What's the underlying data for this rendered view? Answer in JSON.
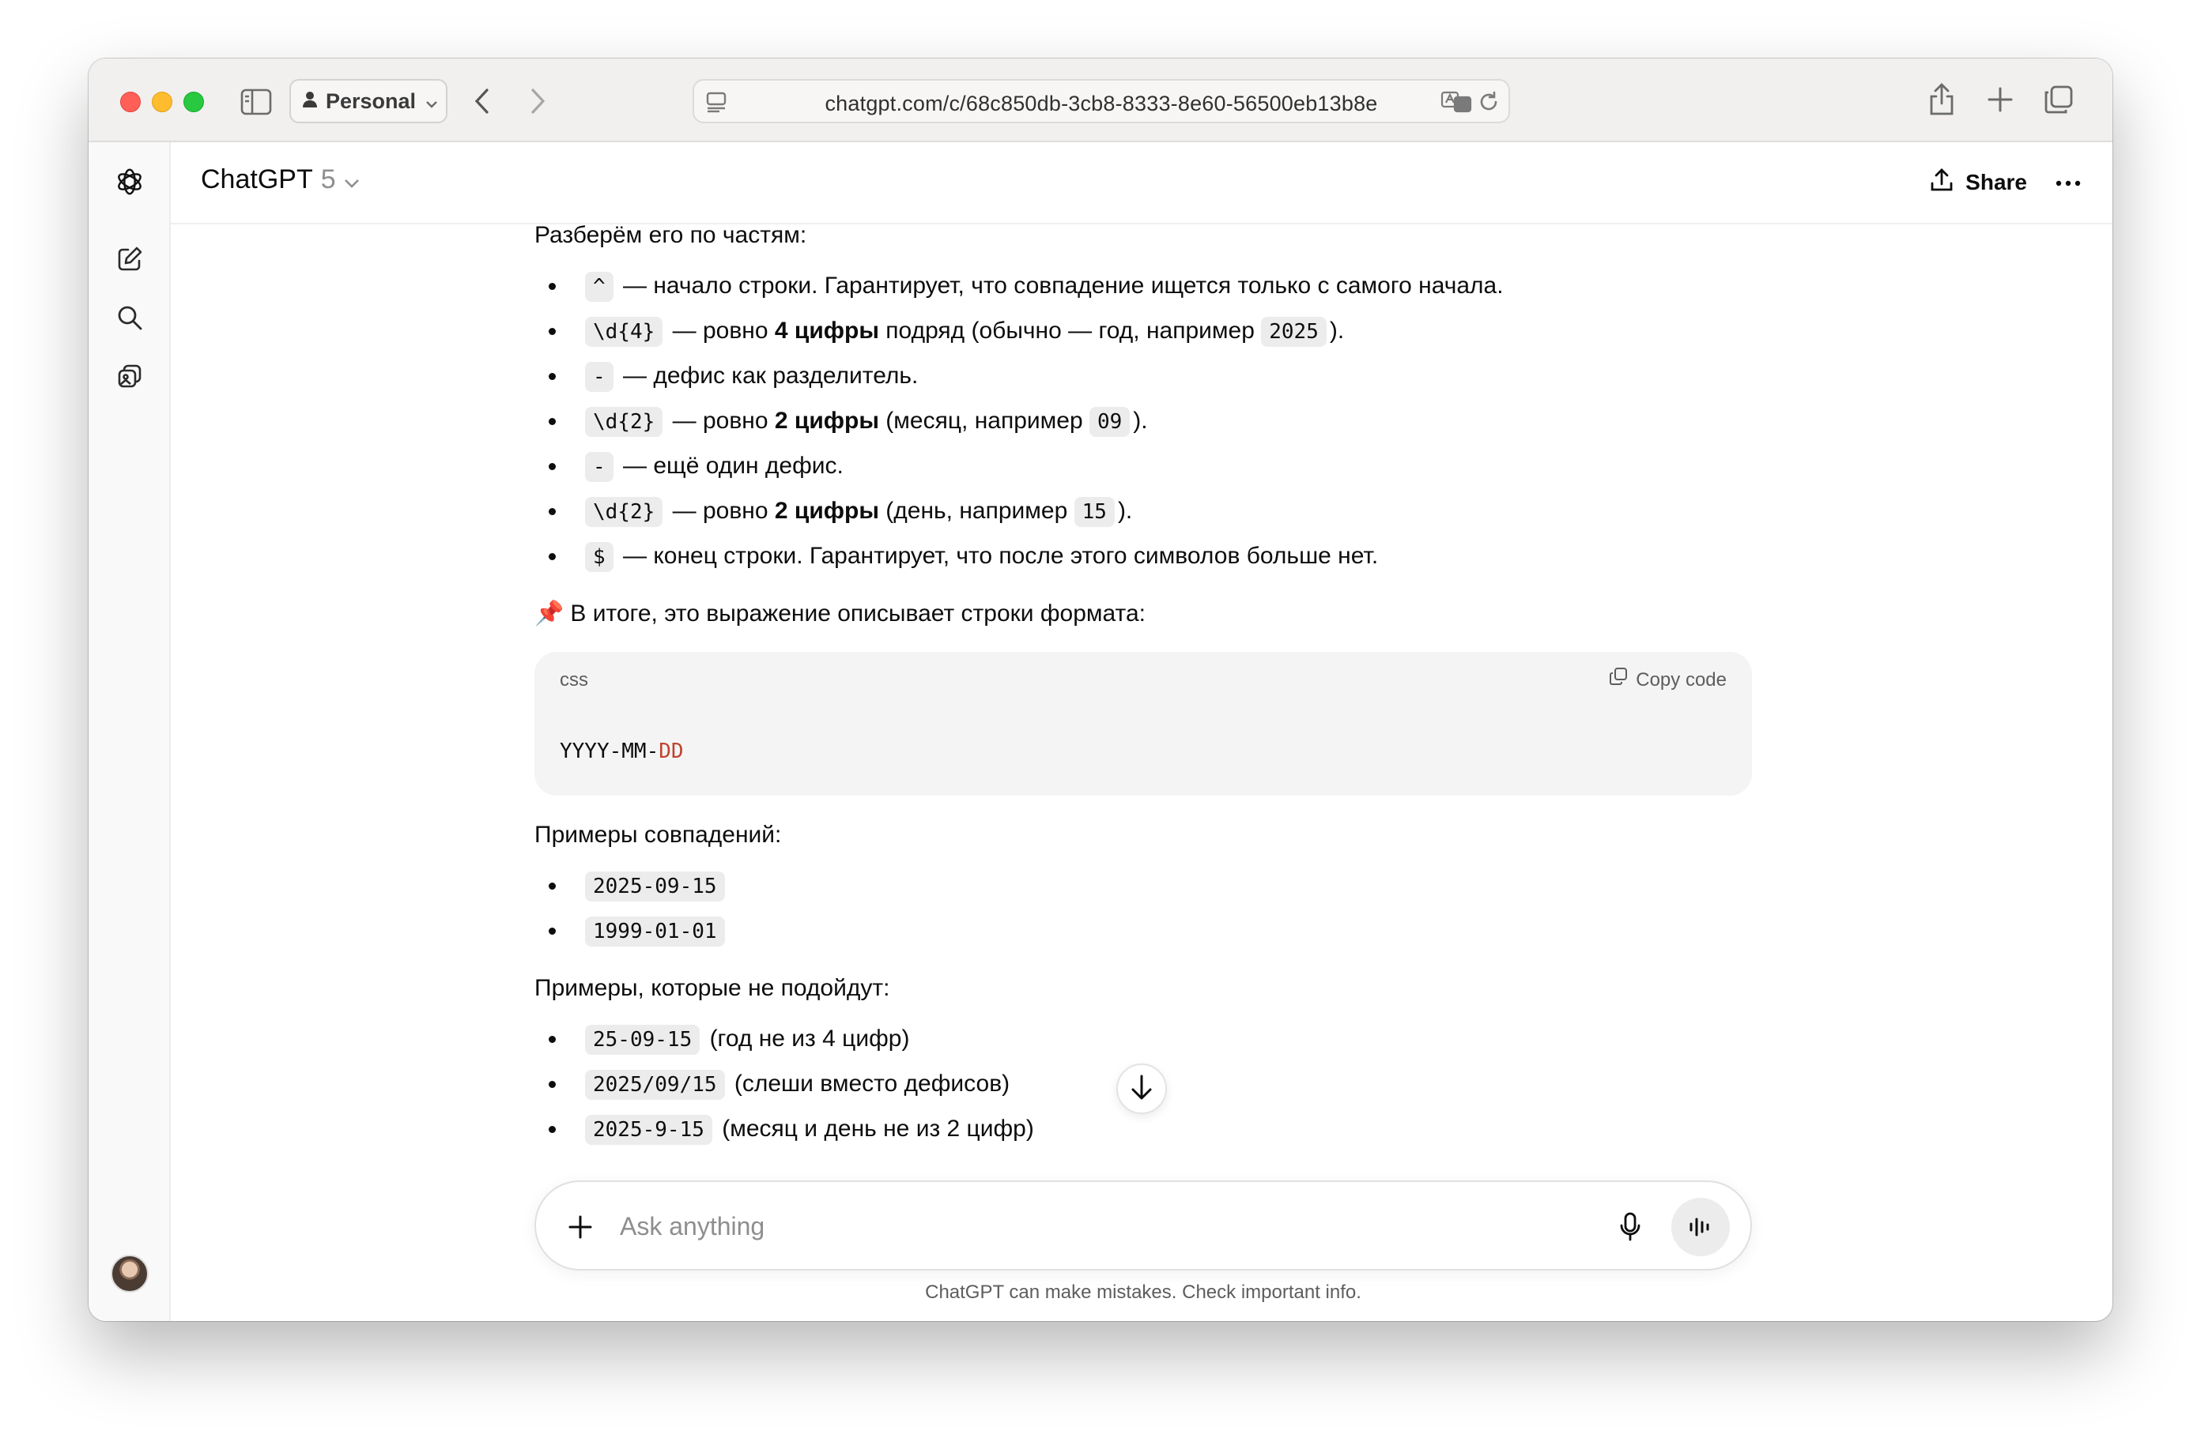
{
  "browser": {
    "profile_label": "Personal",
    "url": "chatgpt.com/c/68c850db-3cb8-8333-8e60-56500eb13b8e"
  },
  "header": {
    "app_name": "ChatGPT",
    "model_version": "5",
    "share_label": "Share"
  },
  "message": {
    "intro": "Разберём его по частям:",
    "parts": [
      {
        "code": "^",
        "segments": [
          {
            "t": " — начало строки. Гарантирует, что совпадение ищется только с самого начала.",
            "bold": false
          }
        ]
      },
      {
        "code": "\\d{4}",
        "segments": [
          {
            "t": " — ровно ",
            "bold": false
          },
          {
            "t": "4 цифры",
            "bold": true
          },
          {
            "t": " подряд (обычно — год, например ",
            "bold": false
          },
          {
            "code": "2025"
          },
          {
            "t": ").",
            "bold": false
          }
        ]
      },
      {
        "code": "-",
        "segments": [
          {
            "t": " — дефис как разделитель.",
            "bold": false
          }
        ]
      },
      {
        "code": "\\d{2}",
        "segments": [
          {
            "t": " — ровно ",
            "bold": false
          },
          {
            "t": "2 цифры",
            "bold": true
          },
          {
            "t": " (месяц, например ",
            "bold": false
          },
          {
            "code": "09"
          },
          {
            "t": ").",
            "bold": false
          }
        ]
      },
      {
        "code": "-",
        "segments": [
          {
            "t": " — ещё один дефис.",
            "bold": false
          }
        ]
      },
      {
        "code": "\\d{2}",
        "segments": [
          {
            "t": " — ровно ",
            "bold": false
          },
          {
            "t": "2 цифры",
            "bold": true
          },
          {
            "t": " (день, например ",
            "bold": false
          },
          {
            "code": "15"
          },
          {
            "t": ").",
            "bold": false
          }
        ]
      },
      {
        "code": "$",
        "segments": [
          {
            "t": " — конец строки. Гарантирует, что после этого символов больше нет.",
            "bold": false
          }
        ]
      }
    ],
    "summary_icon": "📌",
    "summary": "В итоге, это выражение описывает строки формата:",
    "codeblock": {
      "lang": "css",
      "copy_label": "Copy code",
      "code_plain": "YYYY-MM-",
      "code_accent": "DD"
    },
    "matches_heading": "Примеры совпадений:",
    "matches": [
      "2025-09-15",
      "1999-01-01"
    ],
    "nonmatches_heading": "Примеры, которые не подойдут:",
    "nonmatches": [
      {
        "code": "25-09-15",
        "note": " (год не из 4 цифр)"
      },
      {
        "code": "2025/09/15",
        "note": " (слеши вместо дефисов)"
      },
      {
        "code": "2025-9-15",
        "note": " (месяц и день не из 2 цифр)"
      }
    ]
  },
  "composer": {
    "placeholder": "Ask anything"
  },
  "disclaimer": "ChatGPT can make mistakes. Check important info.",
  "colors": {
    "accent_code": "#c0432f",
    "traffic_red": "#ff5f57",
    "traffic_yellow": "#febc2e",
    "traffic_green": "#28c840"
  }
}
